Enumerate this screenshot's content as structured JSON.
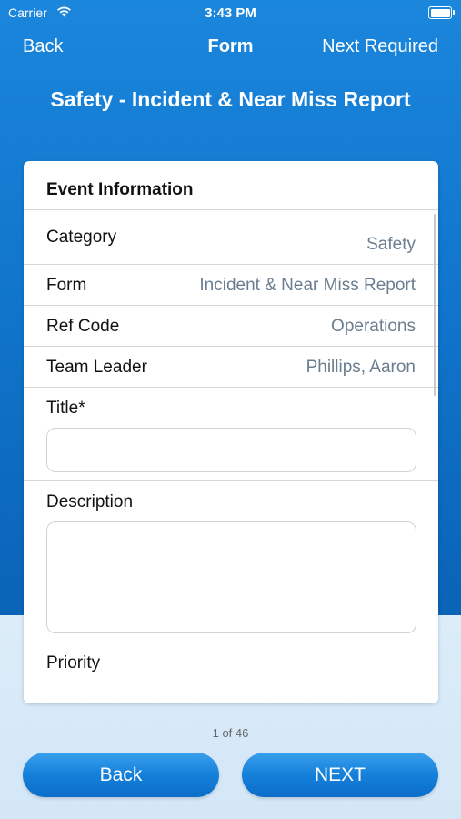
{
  "status_bar": {
    "carrier": "Carrier",
    "time": "3:43 PM",
    "wifi_icon": "wifi-icon",
    "battery_icon": "battery-icon"
  },
  "nav": {
    "back_label": "Back",
    "title": "Form",
    "next_required_label": "Next Required"
  },
  "page_title": "Safety - Incident & Near Miss Report",
  "card": {
    "section_header": "Event Information",
    "rows": [
      {
        "label": "Category",
        "value": "Safety"
      },
      {
        "label": "Form",
        "value": "Incident & Near Miss Report"
      },
      {
        "label": "Ref Code",
        "value": "Operations"
      },
      {
        "label": "Team Leader",
        "value": "Phillips, Aaron"
      }
    ],
    "title_field": {
      "label": "Title*",
      "value": ""
    },
    "description_field": {
      "label": "Description",
      "value": ""
    },
    "priority_label": "Priority"
  },
  "footer": {
    "page_counter": "1 of 46",
    "back_button": "Back",
    "next_button": "NEXT"
  },
  "colors": {
    "primary_blue": "#1480da",
    "value_gray": "#6a7e90",
    "light_bg": "#d9ebf8"
  }
}
